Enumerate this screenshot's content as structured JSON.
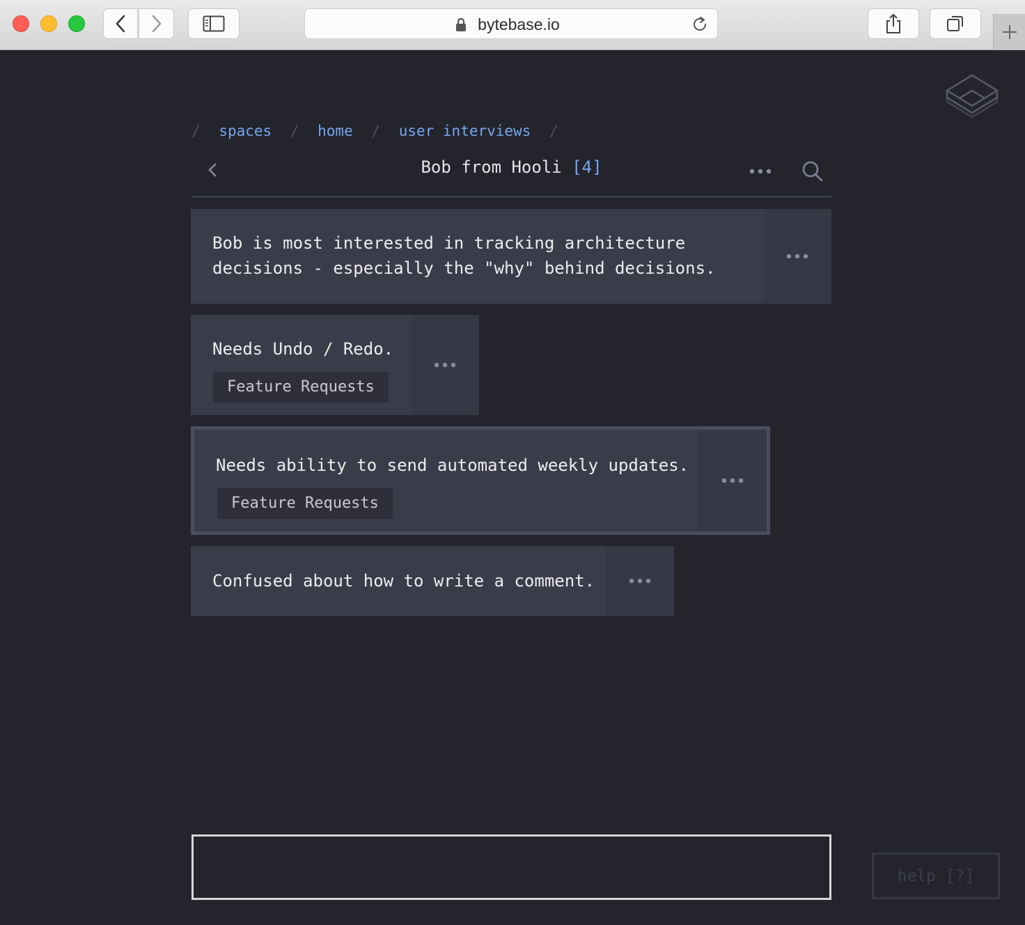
{
  "browser": {
    "url": "bytebase.io",
    "icons": [
      "back-icon",
      "forward-icon",
      "sidebar-icon",
      "lock-icon",
      "reload-icon",
      "share-icon",
      "tabs-icon",
      "plus-icon"
    ]
  },
  "breadcrumb": {
    "separator": "/",
    "items": [
      "spaces",
      "home",
      "user interviews"
    ]
  },
  "header": {
    "title": "Bob from Hooli",
    "count": "[4]"
  },
  "notes": [
    {
      "lines": [
        "Bob is most interested in tracking architecture",
        "decisions - especially the \"why\" behind decisions."
      ],
      "tag": null
    },
    {
      "lines": [
        "Needs Undo / Redo."
      ],
      "tag": "Feature Requests"
    },
    {
      "lines": [
        "Needs ability to send automated weekly updates."
      ],
      "tag": "Feature Requests",
      "selected": true
    },
    {
      "lines": [
        "Confused about how to write a comment."
      ],
      "tag": null
    }
  ],
  "input": {
    "value": ""
  },
  "help": {
    "label": "help [?]"
  },
  "colors": {
    "accent": "#76a6ef",
    "background": "#23242c",
    "card": "#3b3c4a"
  }
}
